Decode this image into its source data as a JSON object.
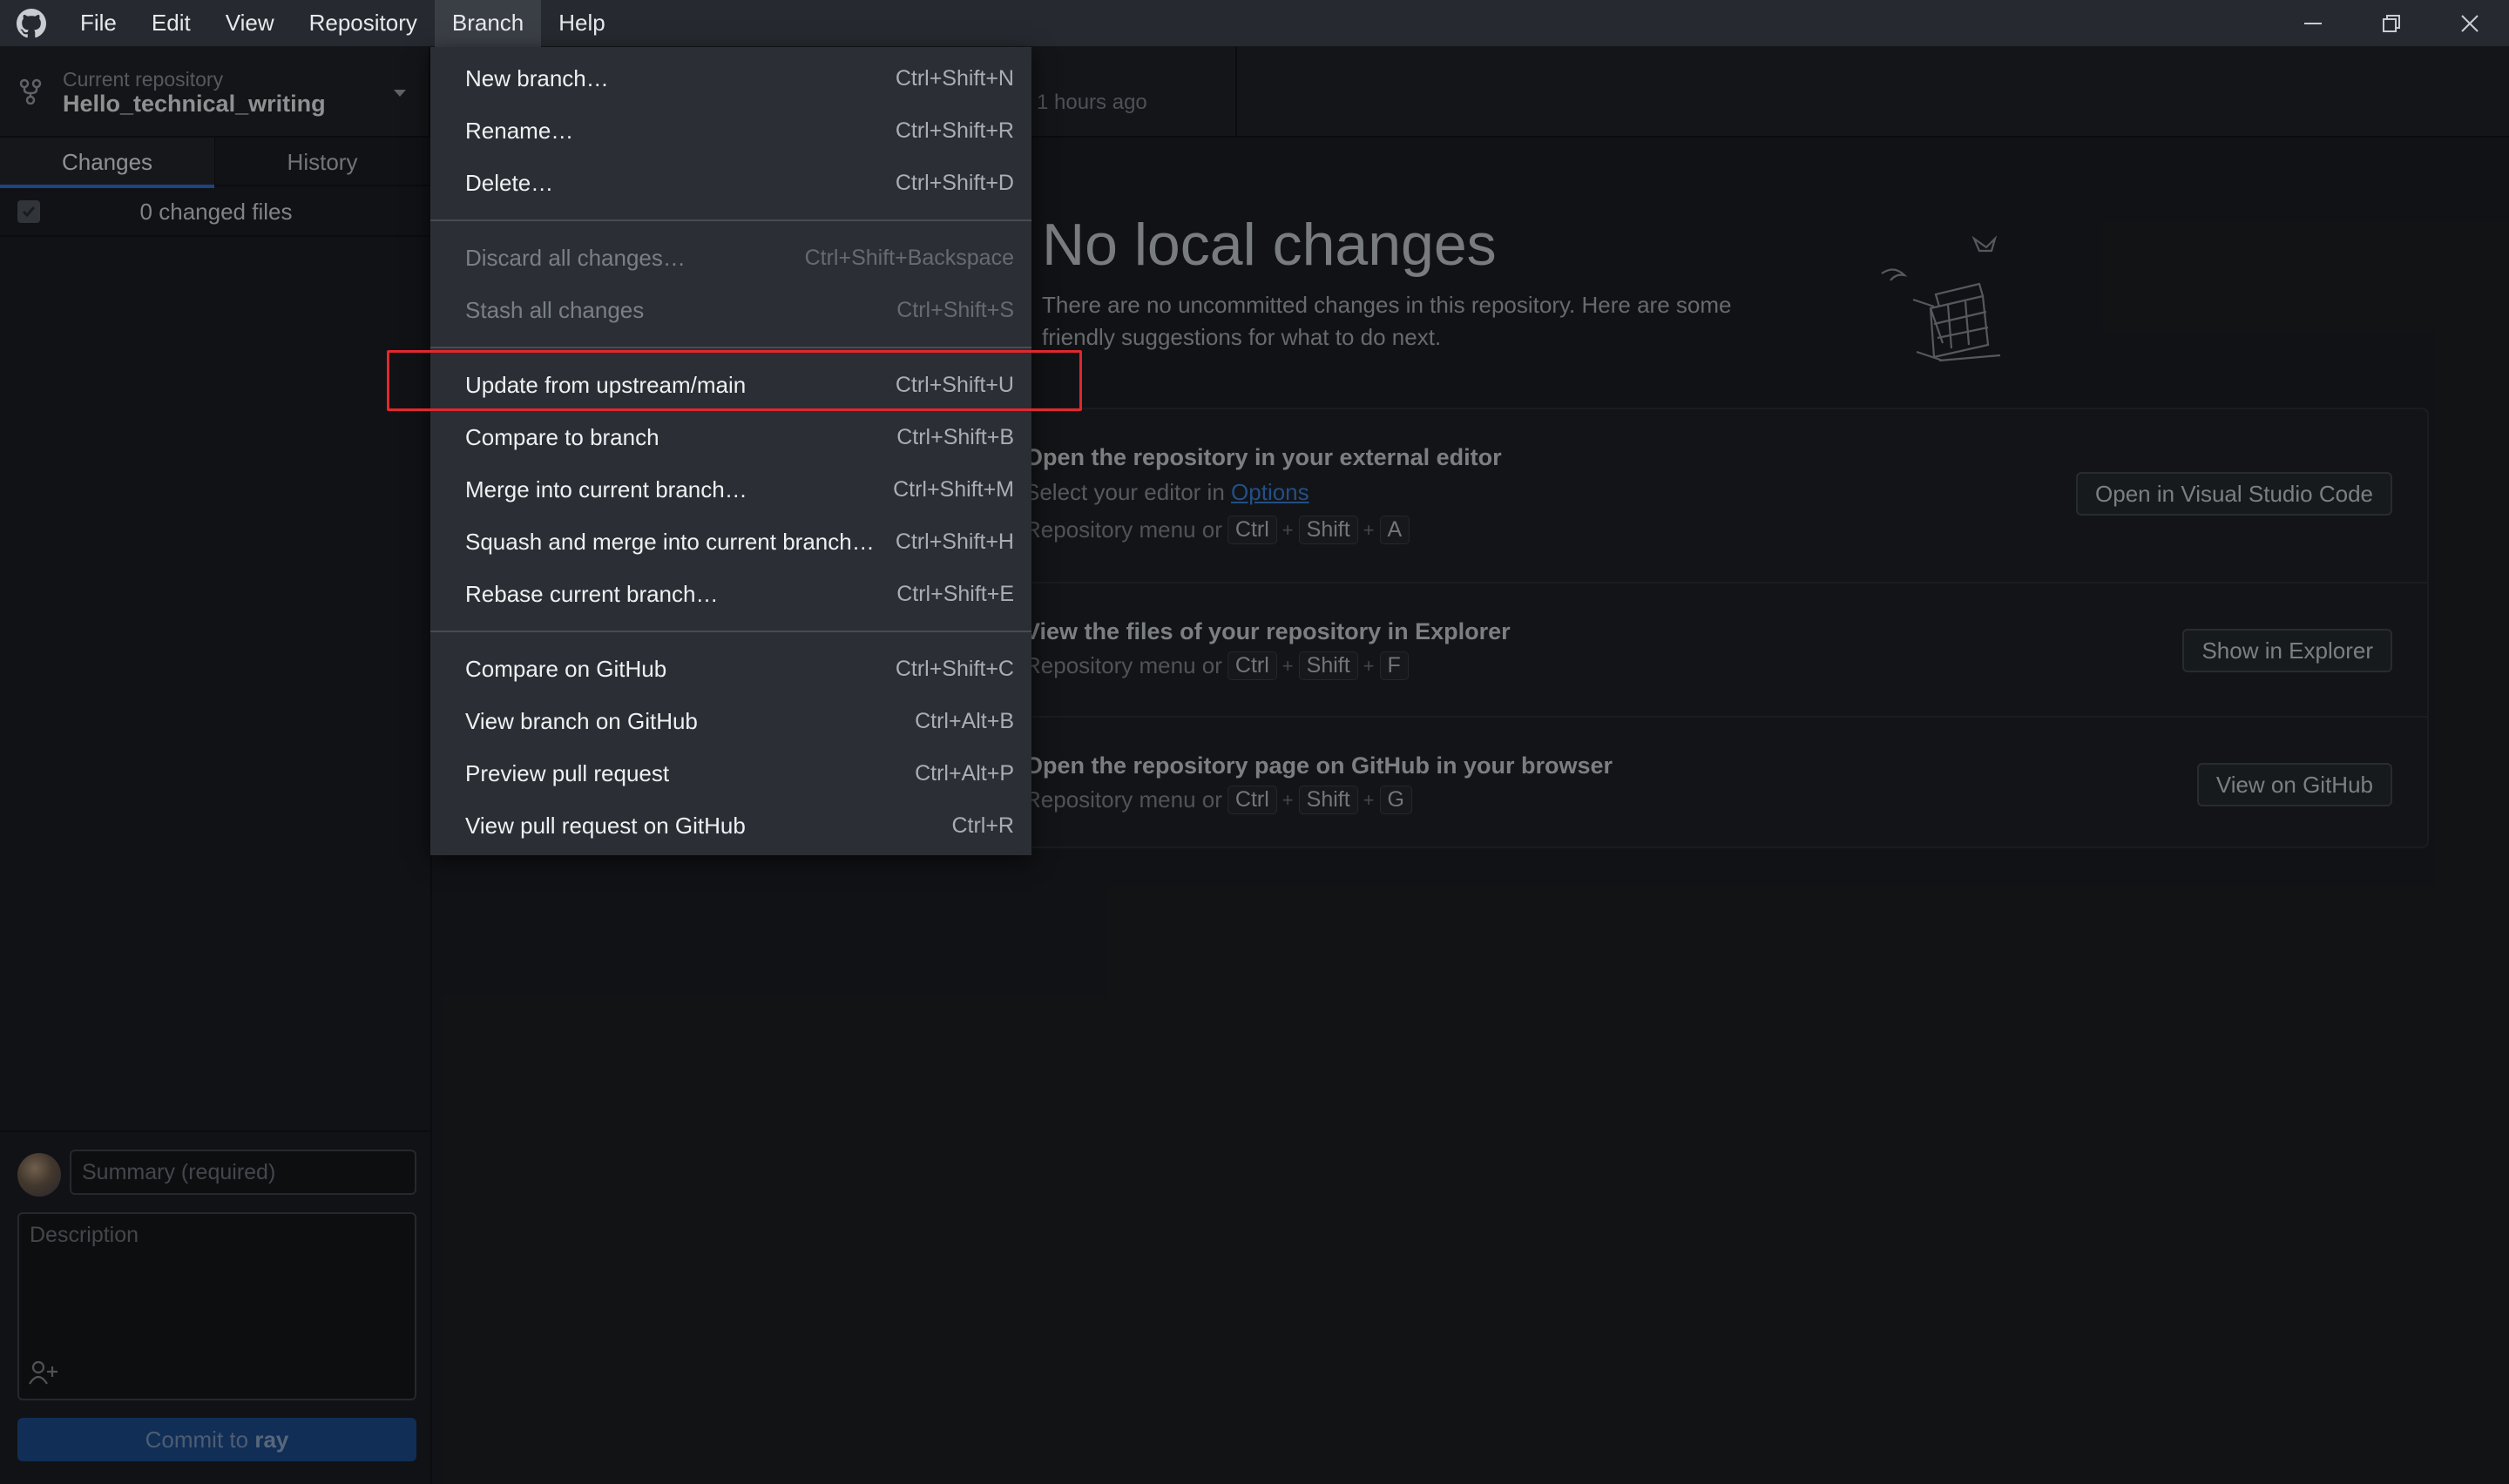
{
  "menubar": {
    "items": [
      "File",
      "Edit",
      "View",
      "Repository",
      "Branch",
      "Help"
    ],
    "active": "Branch"
  },
  "toolbar": {
    "repo_caption": "Current repository",
    "repo_name": "Hello_technical_writing",
    "fetch_sub": "1 hours ago"
  },
  "sidebar": {
    "tabs": [
      "Changes",
      "History"
    ],
    "changed_files": "0 changed files",
    "summary_placeholder": "Summary (required)",
    "description_placeholder": "Description",
    "commit_prefix": "Commit to",
    "commit_branch": "ray"
  },
  "main": {
    "heading": "No local changes",
    "intro": "There are no uncommitted changes in this repository. Here are some friendly suggestions for what to do next.",
    "cards": [
      {
        "title": "Open the repository in your external editor",
        "desc_prefix": "Select your editor in",
        "desc_link": "Options",
        "keys_prefix": "Repository menu or",
        "keys": [
          "Ctrl",
          "Shift",
          "A"
        ],
        "button": "Open in Visual Studio Code"
      },
      {
        "title": "View the files of your repository in Explorer",
        "keys_prefix": "Repository menu or",
        "keys": [
          "Ctrl",
          "Shift",
          "F"
        ],
        "button": "Show in Explorer"
      },
      {
        "title": "Open the repository page on GitHub in your browser",
        "keys_prefix": "Repository menu or",
        "keys": [
          "Ctrl",
          "Shift",
          "G"
        ],
        "button": "View on GitHub"
      }
    ]
  },
  "branch_menu": {
    "groups": [
      [
        {
          "label": "New branch…",
          "accel": "Ctrl+Shift+N",
          "enabled": true
        },
        {
          "label": "Rename…",
          "accel": "Ctrl+Shift+R",
          "enabled": true
        },
        {
          "label": "Delete…",
          "accel": "Ctrl+Shift+D",
          "enabled": true
        }
      ],
      [
        {
          "label": "Discard all changes…",
          "accel": "Ctrl+Shift+Backspace",
          "enabled": false
        },
        {
          "label": "Stash all changes",
          "accel": "Ctrl+Shift+S",
          "enabled": false
        }
      ],
      [
        {
          "label": "Update from upstream/main",
          "accel": "Ctrl+Shift+U",
          "enabled": true,
          "highlighted": true
        },
        {
          "label": "Compare to branch",
          "accel": "Ctrl+Shift+B",
          "enabled": true
        },
        {
          "label": "Merge into current branch…",
          "accel": "Ctrl+Shift+M",
          "enabled": true
        },
        {
          "label": "Squash and merge into current branch…",
          "accel": "Ctrl+Shift+H",
          "enabled": true
        },
        {
          "label": "Rebase current branch…",
          "accel": "Ctrl+Shift+E",
          "enabled": true
        }
      ],
      [
        {
          "label": "Compare on GitHub",
          "accel": "Ctrl+Shift+C",
          "enabled": true
        },
        {
          "label": "View branch on GitHub",
          "accel": "Ctrl+Alt+B",
          "enabled": true
        },
        {
          "label": "Preview pull request",
          "accel": "Ctrl+Alt+P",
          "enabled": true
        },
        {
          "label": "View pull request on GitHub",
          "accel": "Ctrl+R",
          "enabled": true
        }
      ]
    ]
  },
  "colors": {
    "highlight_box": "#e0282e",
    "accent": "#2f6fd6",
    "commit_button": "#1c4b8c"
  }
}
